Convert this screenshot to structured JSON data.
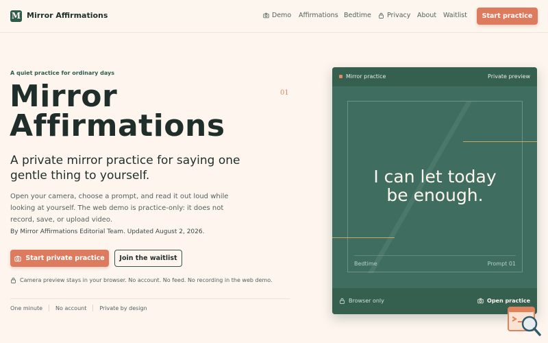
{
  "brand": {
    "logo_letter": "M",
    "name": "Mirror Affirmations",
    "color": "#2f5b4d"
  },
  "nav": {
    "items": [
      {
        "label": "Demo",
        "icon": "camera-icon"
      },
      {
        "label": "Affirmations",
        "icon": ""
      },
      {
        "label": "Bedtime",
        "icon": ""
      },
      {
        "label": "Privacy",
        "icon": "lock-icon"
      },
      {
        "label": "About",
        "icon": ""
      },
      {
        "label": "Waitlist",
        "icon": ""
      }
    ],
    "cta_label": "Start practice"
  },
  "hero": {
    "eyebrow": "A quiet practice for ordinary days",
    "title_line1": "Mirror",
    "title_line2": "Affirmations",
    "number": "01",
    "subtitle": "A private mirror practice for saying one gentle thing to yourself.",
    "description": "Open your camera, choose a prompt, and read it out loud while looking at yourself. The web demo is practice-only: it does not record, save, or upload video.",
    "byline": "By Mirror Affirmations Editorial Team. Updated August 2, 2026.",
    "primary_button": "Start private practice",
    "secondary_button": "Join the waitlist",
    "privacy_note": "Camera preview stays in your browser. No account. No feed. No recording in the web demo.",
    "features": [
      "One minute",
      "No account",
      "Private by design"
    ]
  },
  "card": {
    "header_left": "Mirror practice",
    "header_right": "Private preview",
    "affirmation_line1": "I can let today",
    "affirmation_line2": "be enough.",
    "category": "Bedtime",
    "prompt": "Prompt 01",
    "footer_left": "Browser only",
    "footer_right": "Open practice"
  },
  "colors": {
    "background": "#fdf5ee",
    "accent": "#dd7b5e",
    "brand_green": "#2f5b4d",
    "card_green": "#3f6e60",
    "gold": "#c7a96a"
  }
}
